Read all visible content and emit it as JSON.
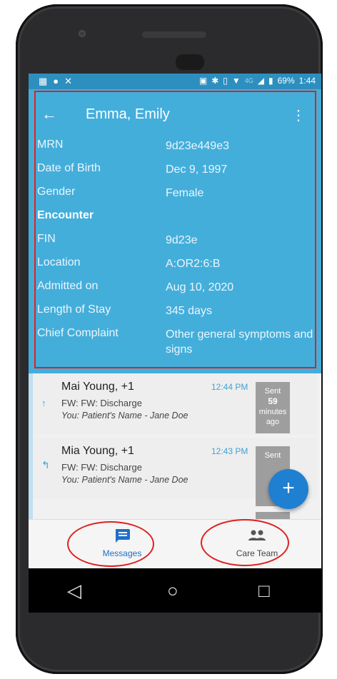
{
  "status": {
    "battery": "69%",
    "time": "1:44",
    "network": "4G"
  },
  "header": {
    "back_icon": "arrow-left-icon",
    "title": "Emma, Emily",
    "menu_icon": "more-vert-icon"
  },
  "details": {
    "mrn_label": "MRN",
    "mrn_value": "9d23e449e3",
    "dob_label": "Date of Birth",
    "dob_value": "Dec 9, 1997",
    "gender_label": "Gender",
    "gender_value": "Female",
    "encounter_heading": "Encounter",
    "fin_label": "FIN",
    "fin_value": "9d23e",
    "location_label": "Location",
    "location_value": "A:OR2:6:B",
    "admitted_label": "Admitted on",
    "admitted_value": "Aug 10, 2020",
    "los_label": "Length of Stay",
    "los_value": "345 days",
    "complaint_label": "Chief Complaint",
    "complaint_value": "Other general symptoms and signs"
  },
  "messages": [
    {
      "name": "Mai Young, +1",
      "time": "12:44 PM",
      "subject": "FW: FW: Discharge",
      "snippet": "You: Patient's Name - Jane Doe",
      "status_line1": "Sent",
      "status_line2": "59",
      "status_line3": "minutes",
      "status_line4": "ago"
    },
    {
      "name": "Mia Young, +1",
      "time": "12:43 PM",
      "subject": "FW: FW: Discharge",
      "snippet": "You: Patient's Name - Jane Doe",
      "status_line1": "Sent"
    }
  ],
  "fab": {
    "label": "+"
  },
  "nav": {
    "messages_label": "Messages",
    "care_team_label": "Care Team"
  },
  "system": {
    "back": "◁",
    "home": "○",
    "recents": "□"
  },
  "colors": {
    "header_blue": "#44aedb",
    "accent_blue": "#1f7fd1",
    "highlight_red": "#e02020"
  }
}
